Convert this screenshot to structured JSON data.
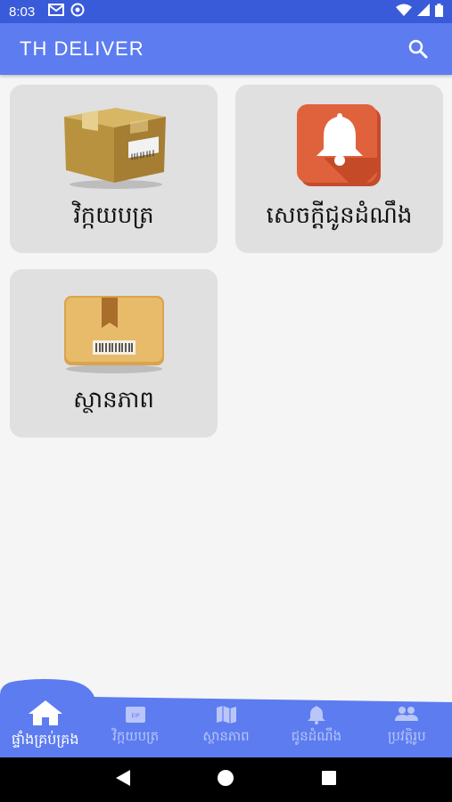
{
  "status_bar": {
    "time": "8:03"
  },
  "app_bar": {
    "title": "TH DELIVER"
  },
  "cards": [
    {
      "label": "វិក្កយបត្រ",
      "icon": "cardboard-box-icon"
    },
    {
      "label": "សេចក្តីជូនដំណឹង",
      "icon": "bell-icon"
    },
    {
      "label": "ស្ថានភាព",
      "icon": "package-barcode-icon"
    }
  ],
  "bottom_nav": {
    "items": [
      {
        "label": "ផ្ទាំងគ្រប់គ្រង",
        "icon": "home-icon",
        "active": true
      },
      {
        "label": "វិក្កយបត្រ",
        "icon": "invoice-icon",
        "active": false
      },
      {
        "label": "ស្ថានភាព",
        "icon": "map-icon",
        "active": false
      },
      {
        "label": "ជូនដំណឹង",
        "icon": "bell-icon",
        "active": false
      },
      {
        "label": "ប្រវត្តិរូប",
        "icon": "people-icon",
        "active": false
      }
    ]
  },
  "colors": {
    "status_bar": "#3a5bd9",
    "app_bar": "#5c7cf0",
    "nav": "#5c7cf0",
    "card": "#e0e0e0"
  }
}
